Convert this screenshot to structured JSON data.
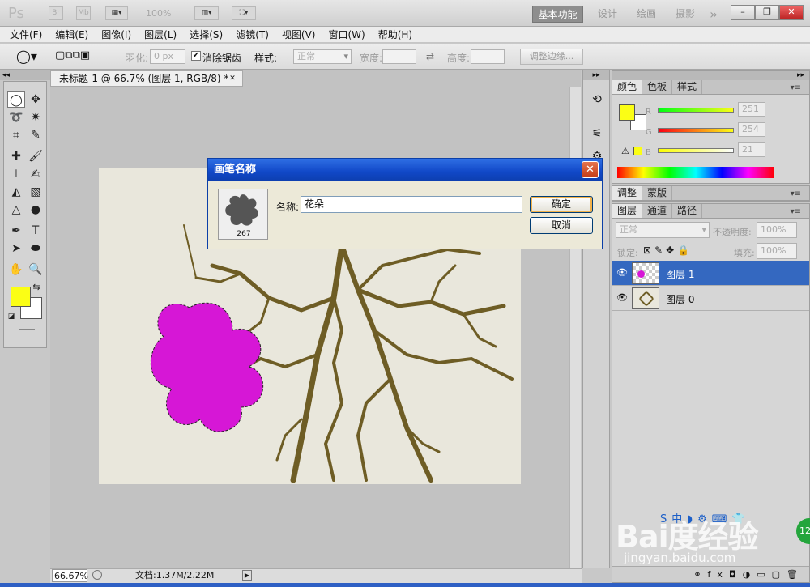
{
  "app": {
    "logo": "Ps",
    "bridge_btn": "Br",
    "minibridge_btn": "Mb",
    "zoom": "100%",
    "workspaces": [
      "基本功能",
      "设计",
      "绘画",
      "摄影",
      "»"
    ]
  },
  "menu": [
    "文件(F)",
    "编辑(E)",
    "图像(I)",
    "图层(L)",
    "选择(S)",
    "滤镜(T)",
    "视图(V)",
    "窗口(W)",
    "帮助(H)"
  ],
  "options": {
    "feather_label": "羽化:",
    "feather_value": "0 px",
    "antialias_label": "消除锯齿",
    "style_label": "样式:",
    "style_value": "正常",
    "width_label": "宽度:",
    "height_label": "高度:",
    "refine_edge": "调整边缘..."
  },
  "document": {
    "tab_title": "未标题-1 @ 66.7% (图层 1, RGB/8) *",
    "zoom": "66.67%",
    "doc_size": "文档:1.37M/2.22M"
  },
  "colors": {
    "foreground": "#fbfe15",
    "background": "#ffffff",
    "flower": "#d617d6",
    "branch": "#6e5d25"
  },
  "color_panel": {
    "tabs": [
      "颜色",
      "色板",
      "样式"
    ],
    "r_label": "R",
    "g_label": "G",
    "b_label": "B",
    "r": "251",
    "g": "254",
    "b": "21"
  },
  "adjust_panel": {
    "tabs": [
      "调整",
      "蒙版"
    ]
  },
  "layers_panel": {
    "tabs": [
      "图层",
      "通道",
      "路径"
    ],
    "blend_mode": "正常",
    "opacity_label": "不透明度:",
    "opacity": "100%",
    "lock_label": "锁定:",
    "fill_label": "填充:",
    "fill": "100%",
    "layers": [
      {
        "name": "图层 1",
        "selected": true
      },
      {
        "name": "图层 0",
        "selected": false
      }
    ]
  },
  "dialog": {
    "title": "画笔名称",
    "brush_size": "267",
    "name_label": "名称:",
    "name_value": "花朵",
    "ok": "确定",
    "cancel": "取消"
  },
  "watermark": {
    "logo": "Bai度经验",
    "url": "jingyan.baidu.com",
    "badge": "12"
  }
}
